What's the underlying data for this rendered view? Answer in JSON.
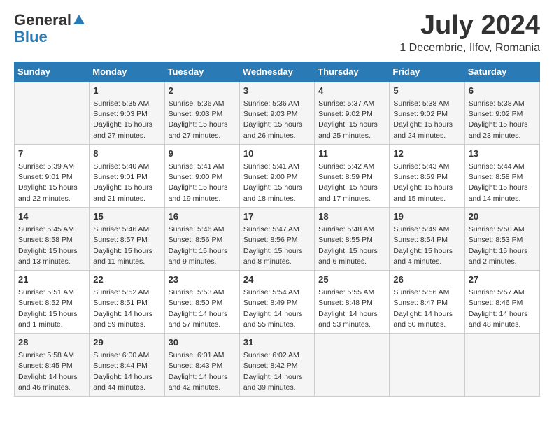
{
  "header": {
    "logo_general": "General",
    "logo_blue": "Blue",
    "title": "July 2024",
    "location": "1 Decembrie, Ilfov, Romania"
  },
  "days_of_week": [
    "Sunday",
    "Monday",
    "Tuesday",
    "Wednesday",
    "Thursday",
    "Friday",
    "Saturday"
  ],
  "weeks": [
    [
      {
        "day": "",
        "empty": true
      },
      {
        "day": "1",
        "sunrise": "Sunrise: 5:35 AM",
        "sunset": "Sunset: 9:03 PM",
        "daylight": "Daylight: 15 hours and 27 minutes."
      },
      {
        "day": "2",
        "sunrise": "Sunrise: 5:36 AM",
        "sunset": "Sunset: 9:03 PM",
        "daylight": "Daylight: 15 hours and 27 minutes."
      },
      {
        "day": "3",
        "sunrise": "Sunrise: 5:36 AM",
        "sunset": "Sunset: 9:03 PM",
        "daylight": "Daylight: 15 hours and 26 minutes."
      },
      {
        "day": "4",
        "sunrise": "Sunrise: 5:37 AM",
        "sunset": "Sunset: 9:02 PM",
        "daylight": "Daylight: 15 hours and 25 minutes."
      },
      {
        "day": "5",
        "sunrise": "Sunrise: 5:38 AM",
        "sunset": "Sunset: 9:02 PM",
        "daylight": "Daylight: 15 hours and 24 minutes."
      },
      {
        "day": "6",
        "sunrise": "Sunrise: 5:38 AM",
        "sunset": "Sunset: 9:02 PM",
        "daylight": "Daylight: 15 hours and 23 minutes."
      }
    ],
    [
      {
        "day": "7",
        "sunrise": "Sunrise: 5:39 AM",
        "sunset": "Sunset: 9:01 PM",
        "daylight": "Daylight: 15 hours and 22 minutes."
      },
      {
        "day": "8",
        "sunrise": "Sunrise: 5:40 AM",
        "sunset": "Sunset: 9:01 PM",
        "daylight": "Daylight: 15 hours and 21 minutes."
      },
      {
        "day": "9",
        "sunrise": "Sunrise: 5:41 AM",
        "sunset": "Sunset: 9:00 PM",
        "daylight": "Daylight: 15 hours and 19 minutes."
      },
      {
        "day": "10",
        "sunrise": "Sunrise: 5:41 AM",
        "sunset": "Sunset: 9:00 PM",
        "daylight": "Daylight: 15 hours and 18 minutes."
      },
      {
        "day": "11",
        "sunrise": "Sunrise: 5:42 AM",
        "sunset": "Sunset: 8:59 PM",
        "daylight": "Daylight: 15 hours and 17 minutes."
      },
      {
        "day": "12",
        "sunrise": "Sunrise: 5:43 AM",
        "sunset": "Sunset: 8:59 PM",
        "daylight": "Daylight: 15 hours and 15 minutes."
      },
      {
        "day": "13",
        "sunrise": "Sunrise: 5:44 AM",
        "sunset": "Sunset: 8:58 PM",
        "daylight": "Daylight: 15 hours and 14 minutes."
      }
    ],
    [
      {
        "day": "14",
        "sunrise": "Sunrise: 5:45 AM",
        "sunset": "Sunset: 8:58 PM",
        "daylight": "Daylight: 15 hours and 13 minutes."
      },
      {
        "day": "15",
        "sunrise": "Sunrise: 5:46 AM",
        "sunset": "Sunset: 8:57 PM",
        "daylight": "Daylight: 15 hours and 11 minutes."
      },
      {
        "day": "16",
        "sunrise": "Sunrise: 5:46 AM",
        "sunset": "Sunset: 8:56 PM",
        "daylight": "Daylight: 15 hours and 9 minutes."
      },
      {
        "day": "17",
        "sunrise": "Sunrise: 5:47 AM",
        "sunset": "Sunset: 8:56 PM",
        "daylight": "Daylight: 15 hours and 8 minutes."
      },
      {
        "day": "18",
        "sunrise": "Sunrise: 5:48 AM",
        "sunset": "Sunset: 8:55 PM",
        "daylight": "Daylight: 15 hours and 6 minutes."
      },
      {
        "day": "19",
        "sunrise": "Sunrise: 5:49 AM",
        "sunset": "Sunset: 8:54 PM",
        "daylight": "Daylight: 15 hours and 4 minutes."
      },
      {
        "day": "20",
        "sunrise": "Sunrise: 5:50 AM",
        "sunset": "Sunset: 8:53 PM",
        "daylight": "Daylight: 15 hours and 2 minutes."
      }
    ],
    [
      {
        "day": "21",
        "sunrise": "Sunrise: 5:51 AM",
        "sunset": "Sunset: 8:52 PM",
        "daylight": "Daylight: 15 hours and 1 minute."
      },
      {
        "day": "22",
        "sunrise": "Sunrise: 5:52 AM",
        "sunset": "Sunset: 8:51 PM",
        "daylight": "Daylight: 14 hours and 59 minutes."
      },
      {
        "day": "23",
        "sunrise": "Sunrise: 5:53 AM",
        "sunset": "Sunset: 8:50 PM",
        "daylight": "Daylight: 14 hours and 57 minutes."
      },
      {
        "day": "24",
        "sunrise": "Sunrise: 5:54 AM",
        "sunset": "Sunset: 8:49 PM",
        "daylight": "Daylight: 14 hours and 55 minutes."
      },
      {
        "day": "25",
        "sunrise": "Sunrise: 5:55 AM",
        "sunset": "Sunset: 8:48 PM",
        "daylight": "Daylight: 14 hours and 53 minutes."
      },
      {
        "day": "26",
        "sunrise": "Sunrise: 5:56 AM",
        "sunset": "Sunset: 8:47 PM",
        "daylight": "Daylight: 14 hours and 50 minutes."
      },
      {
        "day": "27",
        "sunrise": "Sunrise: 5:57 AM",
        "sunset": "Sunset: 8:46 PM",
        "daylight": "Daylight: 14 hours and 48 minutes."
      }
    ],
    [
      {
        "day": "28",
        "sunrise": "Sunrise: 5:58 AM",
        "sunset": "Sunset: 8:45 PM",
        "daylight": "Daylight: 14 hours and 46 minutes."
      },
      {
        "day": "29",
        "sunrise": "Sunrise: 6:00 AM",
        "sunset": "Sunset: 8:44 PM",
        "daylight": "Daylight: 14 hours and 44 minutes."
      },
      {
        "day": "30",
        "sunrise": "Sunrise: 6:01 AM",
        "sunset": "Sunset: 8:43 PM",
        "daylight": "Daylight: 14 hours and 42 minutes."
      },
      {
        "day": "31",
        "sunrise": "Sunrise: 6:02 AM",
        "sunset": "Sunset: 8:42 PM",
        "daylight": "Daylight: 14 hours and 39 minutes."
      },
      {
        "day": "",
        "empty": true
      },
      {
        "day": "",
        "empty": true
      },
      {
        "day": "",
        "empty": true
      }
    ]
  ]
}
